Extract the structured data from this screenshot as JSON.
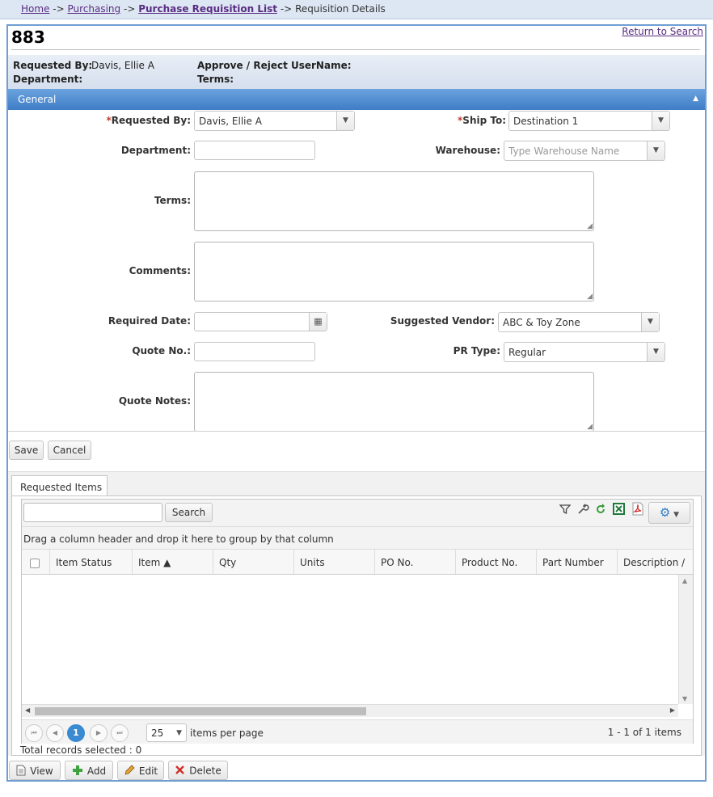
{
  "breadcrumb": {
    "home": "Home",
    "sep1": "->",
    "purchasing": "Purchasing",
    "sep2": "->",
    "list": "Purchase Requisition List",
    "sep3": "->",
    "current": "Requisition Details"
  },
  "header": {
    "title": "883",
    "return_link": "Return to Search"
  },
  "summary": {
    "requested_by_label": "Requested By:",
    "requested_by_value": "Davis, Ellie A",
    "department_label": "Department:",
    "approve_label": "Approve / Reject UserName:",
    "terms_label": "Terms:"
  },
  "general": {
    "section_title": "General",
    "requested_by_label": "Requested By:",
    "requested_by_value": "Davis, Ellie A",
    "ship_to_label": "Ship To:",
    "ship_to_value": "Destination 1",
    "department_label": "Department:",
    "department_value": "",
    "warehouse_label": "Warehouse:",
    "warehouse_placeholder": "Type Warehouse Name",
    "terms_label": "Terms:",
    "comments_label": "Comments:",
    "required_date_label": "Required Date:",
    "required_date_value": "",
    "suggested_vendor_label": "Suggested Vendor:",
    "suggested_vendor_value": "ABC & Toy Zone",
    "quote_no_label": "Quote No.:",
    "quote_no_value": "",
    "pr_type_label": "PR Type:",
    "pr_type_value": "Regular",
    "quote_notes_label": "Quote Notes:",
    "required_marker": "*"
  },
  "form_buttons": {
    "save": "Save",
    "cancel": "Cancel"
  },
  "items_tab": {
    "tab_label": "Requested Items",
    "search_button": "Search",
    "search_value": "",
    "group_hint": "Drag a column header and drop it here to group by that column",
    "columns": [
      "Item Status",
      "Item ▲",
      "Qty",
      "Units",
      "PO No.",
      "Product No.",
      "Part Number",
      "Description /"
    ],
    "pager_current_page": "1",
    "page_size": "25",
    "items_per_page_label": "items per page",
    "range_text": "1 - 1 of 1 items",
    "total_selected": "Total records selected : 0"
  },
  "bottom_buttons": {
    "view": "View",
    "add": "Add",
    "edit": "Edit",
    "delete": "Delete"
  },
  "colors": {
    "accent_blue": "#3f7cc6",
    "link_purple": "#5a2d82",
    "required_red": "#c0392b",
    "pager_current": "#3a8ad2"
  }
}
